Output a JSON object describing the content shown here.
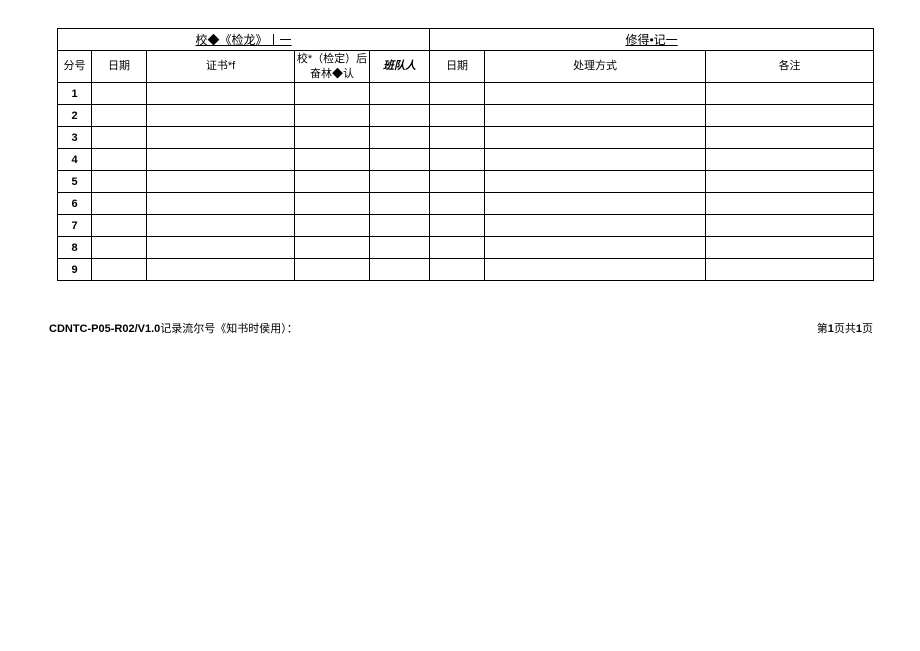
{
  "headers": {
    "group_left": "校◆《检龙》丨一",
    "group_right": "修得•记一",
    "seq": "分号",
    "date1": "日期",
    "cert": "证书*f",
    "confirm_line1": "校*（检定）后",
    "confirm_line2": "奋林◆认",
    "person": "班队人",
    "date2": "日期",
    "method": "处理方式",
    "remark": "各注"
  },
  "rows": [
    "1",
    "2",
    "3",
    "4",
    "5",
    "6",
    "7",
    "8",
    "9"
  ],
  "footer": {
    "code": "CDNTC-P05-R02/V1.0",
    "note": "记录流尔号《知书时侯用）：",
    "page_prefix": "第",
    "page_num": "1",
    "page_mid": "页共",
    "page_total": "1",
    "page_suffix": "页"
  }
}
